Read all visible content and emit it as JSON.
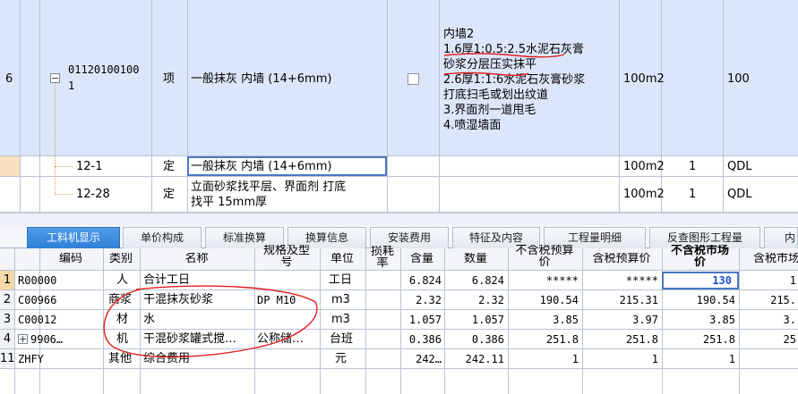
{
  "top_grid": {
    "row_main": {
      "index": "6",
      "code_line1": "01120100100",
      "code_line2": "1",
      "type": "项",
      "name": "一般抹灰 内墙 (14+6mm)",
      "features": [
        "内墙2",
        "1.6厚1:0.5:2.5水泥石灰膏",
        "砂浆分层压实抹平",
        "2.6厚1:1:6水泥石灰膏砂浆",
        "打底扫毛或划出纹道",
        "3.界面剂一道甩毛",
        "4.喷湿墙面"
      ],
      "unit": "100m2",
      "quantity": "100"
    },
    "sub_rows": [
      {
        "code": "12-1",
        "type": "定",
        "name": "一般抹灰 内墙 (14+6mm)",
        "unit": "100m2",
        "qty": "1",
        "flag": "QDL"
      },
      {
        "code": "12-28",
        "type": "定",
        "name_line1": "立面砂浆找平层、界面剂 打底",
        "name_line2": "找平 15mm厚",
        "unit": "100m2",
        "qty": "1",
        "flag": "QDL"
      }
    ]
  },
  "tabs": [
    {
      "label": "工料机显示",
      "active": true
    },
    {
      "label": "单价构成"
    },
    {
      "label": "标准换算"
    },
    {
      "label": "换算信息"
    },
    {
      "label": "安装费用"
    },
    {
      "label": "特征及内容"
    },
    {
      "label": "工程量明细"
    },
    {
      "label": "反查图形工程量"
    },
    {
      "label": "内容"
    }
  ],
  "bottom_grid": {
    "headers": {
      "code": "编码",
      "category": "类别",
      "name": "名称",
      "spec_line1": "规格及型",
      "spec_line2": "号",
      "unit": "单位",
      "loss_line1": "损耗",
      "loss_line2": "率",
      "content": "含量",
      "qty": "数量",
      "ex_budget_line1": "不含税预算",
      "ex_budget_line2": "价",
      "inc_budget": "含税预算价",
      "ex_market_line1": "不含税市场",
      "ex_market_line2": "价",
      "inc_market": "含税市场"
    },
    "rows": [
      {
        "idx": "1",
        "code": "R00000",
        "cat": "人",
        "name": "合计工日",
        "spec": "",
        "unit": "工日",
        "content": "6.824",
        "qty": "6.824",
        "ex_budget": "*****",
        "inc_budget": "*****",
        "ex_market": "130",
        "inc_market": "1"
      },
      {
        "idx": "2",
        "code": "C00966",
        "cat": "商浆",
        "name": "干混抹灰砂浆",
        "spec": "DP M10",
        "unit": "m3",
        "content": "2.32",
        "qty": "2.32",
        "ex_budget": "190.54",
        "inc_budget": "215.31",
        "ex_market": "190.54",
        "inc_market": "215."
      },
      {
        "idx": "3",
        "code": "C00012",
        "cat": "材",
        "name": "水",
        "spec": "",
        "unit": "m3",
        "content": "1.057",
        "qty": "1.057",
        "ex_budget": "3.85",
        "inc_budget": "3.97",
        "ex_market": "3.85",
        "inc_market": "3."
      },
      {
        "idx": "4",
        "code": "9906…",
        "cat": "机",
        "name": "干混砂浆罐式搅…",
        "spec": "公称储…",
        "unit": "台班",
        "content": "0.386",
        "qty": "0.386",
        "ex_budget": "251.8",
        "inc_budget": "251.8",
        "ex_market": "251.8",
        "inc_market": "25"
      },
      {
        "idx": "11",
        "code": "ZHFY",
        "cat": "其他",
        "name": "综合费用",
        "spec": "",
        "unit": "元",
        "content": "242…",
        "qty": "242.11",
        "ex_budget": "1",
        "inc_budget": "1",
        "ex_market": "1",
        "inc_market": ""
      }
    ]
  },
  "colors": {
    "selected_row": "#dce6fa",
    "active_tab": "#2f7fd6",
    "annotation_red": "#e02020"
  }
}
